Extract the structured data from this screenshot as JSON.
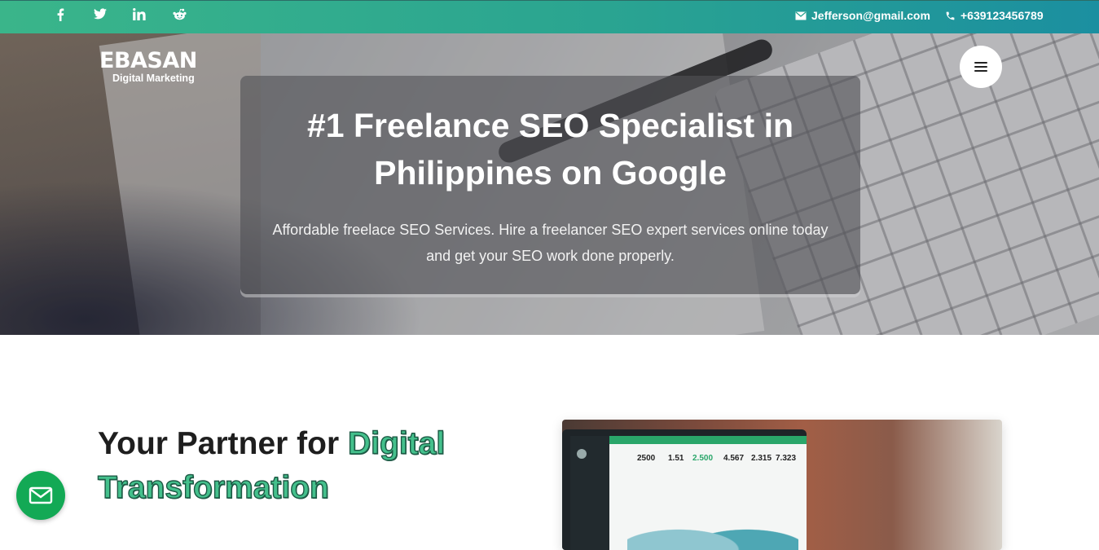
{
  "topbar": {
    "social": [
      {
        "name": "facebook-icon",
        "glyph": "f"
      },
      {
        "name": "twitter-icon",
        "glyph": ""
      },
      {
        "name": "linkedin-icon",
        "glyph": "in"
      },
      {
        "name": "reddit-icon",
        "glyph": ""
      }
    ],
    "email": "Jefferson@gmail.com",
    "phone": "+639123456789",
    "colors": {
      "gradient_start": "#3ab58a",
      "gradient_end": "#1b8fa0"
    }
  },
  "brand": {
    "name": "EBASAN",
    "tagline": "Digital Marketing"
  },
  "hero": {
    "title_line1": "#1 Freelance SEO Specialist in",
    "title_line2": "Philippines on Google",
    "subtitle_line1": "Affordable freelace SEO Services. Hire a freelancer SEO expert services online today",
    "subtitle_line2": "and get your SEO work done properly."
  },
  "section": {
    "heading_plain": "Your Partner for ",
    "heading_highlight1": "Digital",
    "heading_highlight2": "Transformation",
    "accent_color": "#44c08c"
  },
  "dashboard_stats": [
    "2500",
    "1.51",
    "2.500",
    "4.567",
    "2.315",
    "7.323"
  ],
  "floating": {
    "mail_button_color": "#13a955"
  }
}
